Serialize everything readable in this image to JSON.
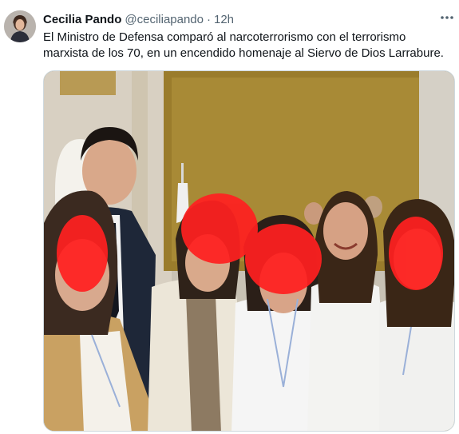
{
  "tweet": {
    "author_name": "Cecilia Pando",
    "handle": "@ceciliapando",
    "separator": "·",
    "timestamp": "12h",
    "text": "El Ministro de Defensa comparó al narcoterrorismo con el terrorismo marxista de los 70, en un encendido homenaje al Siervo de Dios Larrabure.",
    "more_icon": "more-horizontal-icon",
    "media": {
      "type": "photo",
      "description_icon": "photo"
    }
  },
  "colors": {
    "text_primary": "#0f1419",
    "text_secondary": "#536471",
    "border": "#cfd9de",
    "redaction": "#ff2020"
  }
}
